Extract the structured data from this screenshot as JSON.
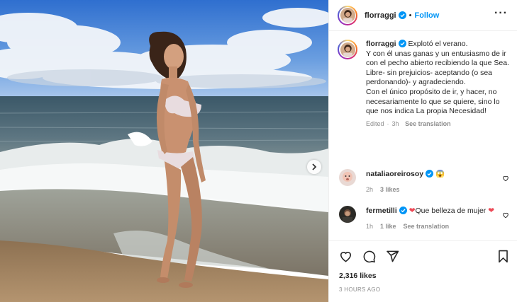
{
  "post": {
    "username": "florraggi",
    "follow_label": "Follow",
    "more_label": "···",
    "caption": "Explotó el verano.\nY con él unas ganas y un entusiasmo de ir con el pecho abierto recibiendo la que Sea. Libre- sin prejuicios- aceptando (o sea perdonando)- y agradeciendo.\nCon el único propósito de ir, y hacer, no necesariamente lo que se quiere, sino lo que nos indica La propia Necesidad!",
    "edited": "Edited",
    "time": "3h",
    "see_translation": "See translation",
    "likes": "2,316 likes",
    "posted_ago": "3 HOURS AGO"
  },
  "comments": [
    {
      "username": "nataliaoreirosoy",
      "text": "😱",
      "time": "2h",
      "likes": "3 likes",
      "reply": ""
    },
    {
      "username": "fermetilli",
      "text": "Que belleza de mujer",
      "time": "1h",
      "likes": "1 like",
      "reply": "See translation"
    }
  ],
  "icons": {
    "verified": "verified-badge-icon",
    "like": "heart-icon",
    "comment": "comment-icon",
    "share": "paper-plane-icon",
    "save": "bookmark-icon",
    "next": "chevron-right-icon"
  },
  "colors": {
    "accent": "#0095f6",
    "heart_red": "#ed4956",
    "muted": "#8e8e8e"
  }
}
